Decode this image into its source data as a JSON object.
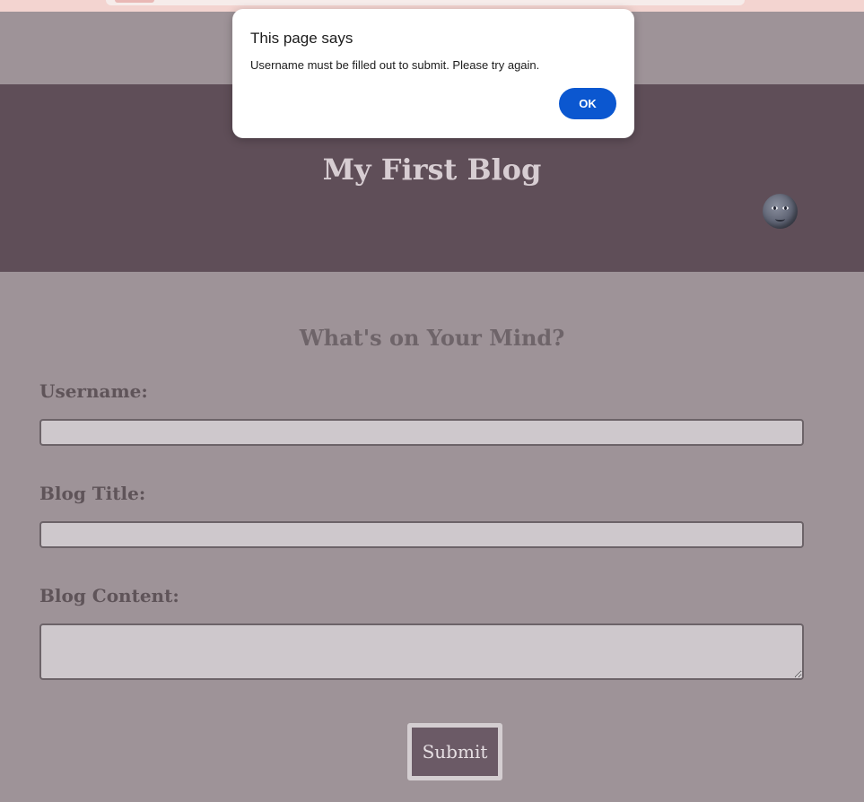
{
  "dialog": {
    "title": "This page says",
    "message": "Username must be filled out to submit. Please try again.",
    "ok_label": "OK"
  },
  "header": {
    "title": "My First Blog",
    "theme_toggle_icon": "new-moon-face-icon"
  },
  "form": {
    "heading": "What's on Your Mind?",
    "username_label": "Username:",
    "username_value": "",
    "blog_title_label": "Blog Title:",
    "blog_title_value": "",
    "blog_content_label": "Blog Content:",
    "blog_content_value": "",
    "submit_label": "Submit"
  },
  "colors": {
    "page_background": "#9e9398",
    "header_background": "#5f4e58",
    "dialog_button": "#0b57d0",
    "submit_background": "#6b5a66"
  }
}
